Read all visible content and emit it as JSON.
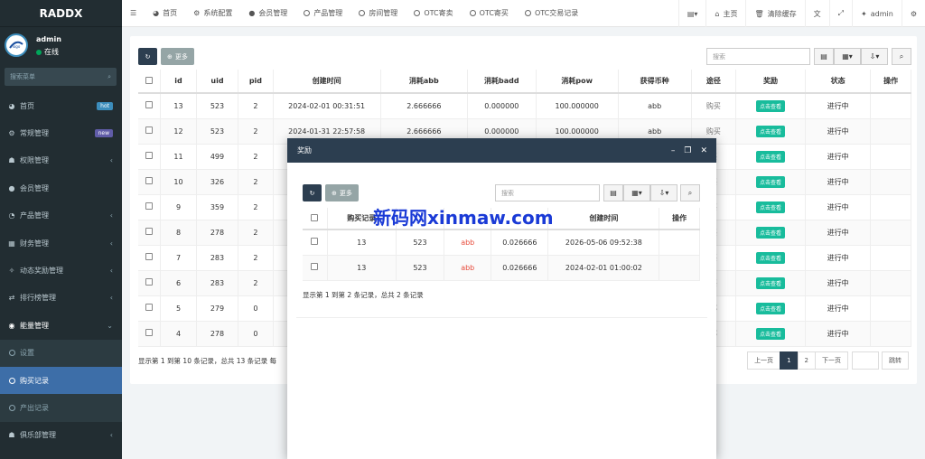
{
  "brand": {
    "title": "RADDX"
  },
  "user": {
    "name": "admin",
    "status": "在线"
  },
  "sidebar": {
    "search_placeholder": "搜索菜单",
    "items": [
      {
        "label": "首页",
        "icon": "dashboard-icon",
        "badge": "hot",
        "badge_color": "#3c8dbc"
      },
      {
        "label": "常规管理",
        "icon": "cogs-icon",
        "badge": "new",
        "badge_color": "#605ca8"
      },
      {
        "label": "权限管理",
        "icon": "group-icon",
        "chev": "‹"
      },
      {
        "label": "会员管理",
        "icon": "user-icon"
      },
      {
        "label": "产品管理",
        "icon": "product-icon",
        "chev": "‹"
      },
      {
        "label": "财务管理",
        "icon": "finance-icon",
        "chev": "‹"
      },
      {
        "label": "动态奖励管理",
        "icon": "reward-icon",
        "chev": "‹"
      },
      {
        "label": "排行榜管理",
        "icon": "rank-icon",
        "chev": "‹"
      },
      {
        "label": "能量管理",
        "icon": "energy-icon",
        "chev": "⌄"
      }
    ],
    "subitems": [
      {
        "label": "设置"
      },
      {
        "label": "购买记录"
      },
      {
        "label": "产出记录"
      }
    ],
    "last_item": {
      "label": "俱乐部管理",
      "icon": "club-icon",
      "chev": "‹"
    }
  },
  "topbar": {
    "tabs": [
      {
        "label": "首页",
        "icon": "dashboard-icon"
      },
      {
        "label": "系统配置",
        "icon": "gear-icon"
      },
      {
        "label": "会员管理",
        "icon": "user-icon"
      },
      {
        "label": "产品管理",
        "icon": "circle-icon"
      },
      {
        "label": "房间管理",
        "icon": "circle-icon"
      },
      {
        "label": "OTC寄卖",
        "icon": "circle-icon"
      },
      {
        "label": "OTC寄买",
        "icon": "circle-icon"
      },
      {
        "label": "OTC交易记录",
        "icon": "circle-icon"
      }
    ],
    "right": {
      "home": "主页",
      "clear_cache": "清除缓存",
      "admin": "admin"
    }
  },
  "toolbar": {
    "more": "更多",
    "search_placeholder": "搜索"
  },
  "table": {
    "columns": [
      "id",
      "uid",
      "pid",
      "创建时间",
      "消耗abb",
      "消耗badd",
      "消耗pow",
      "获得币种",
      "途径",
      "奖励",
      "状态",
      "操作"
    ],
    "rows": [
      {
        "id": "13",
        "uid": "523",
        "pid": "2",
        "time": "2024-02-01 00:31:51",
        "abb": "2.666666",
        "badd": "0.000000",
        "pow": "100.000000",
        "coin": "abb",
        "way": "购买",
        "status": "进行中"
      },
      {
        "id": "12",
        "uid": "523",
        "pid": "2",
        "time": "2024-01-31 22:57:58",
        "abb": "2.666666",
        "badd": "0.000000",
        "pow": "100.000000",
        "coin": "abb",
        "way": "购买",
        "status": "进行中"
      },
      {
        "id": "11",
        "uid": "499",
        "pid": "2",
        "time": "",
        "abb": "",
        "badd": "",
        "pow": "",
        "coin": "",
        "way": "买",
        "status": "进行中"
      },
      {
        "id": "10",
        "uid": "326",
        "pid": "2",
        "time": "",
        "abb": "",
        "badd": "",
        "pow": "",
        "coin": "",
        "way": "买",
        "status": "进行中"
      },
      {
        "id": "9",
        "uid": "359",
        "pid": "2",
        "time": "",
        "abb": "",
        "badd": "",
        "pow": "",
        "coin": "",
        "way": "买",
        "status": "进行中"
      },
      {
        "id": "8",
        "uid": "278",
        "pid": "2",
        "time": "",
        "abb": "",
        "badd": "",
        "pow": "",
        "coin": "",
        "way": "买",
        "status": "进行中"
      },
      {
        "id": "7",
        "uid": "283",
        "pid": "2",
        "time": "",
        "abb": "",
        "badd": "",
        "pow": "",
        "coin": "",
        "way": "买",
        "status": "进行中"
      },
      {
        "id": "6",
        "uid": "283",
        "pid": "2",
        "time": "",
        "abb": "",
        "badd": "",
        "pow": "",
        "coin": "",
        "way": "买",
        "status": "进行中"
      },
      {
        "id": "5",
        "uid": "279",
        "pid": "0",
        "time": "",
        "abb": "",
        "badd": "",
        "pow": "",
        "coin": "",
        "way": "部",
        "status": "进行中"
      },
      {
        "id": "4",
        "uid": "278",
        "pid": "0",
        "time": "",
        "abb": "",
        "badd": "",
        "pow": "",
        "coin": "",
        "way": "部",
        "status": "进行中"
      }
    ],
    "view_label": "点击查看",
    "footer": "显示第 1 到第 10 条记录，总共 13 条记录 每"
  },
  "pager": {
    "prev": "上一页",
    "pages": [
      "1",
      "2"
    ],
    "next": "下一页",
    "jump": "跳转"
  },
  "modal": {
    "title": "奖励",
    "more": "更多",
    "search_placeholder": "搜索",
    "watermark": "新码网xinmaw.com",
    "columns": [
      "购买记录",
      "",
      "",
      "",
      "创建时间",
      "操作"
    ],
    "rows": [
      {
        "rec": "13",
        "uid": "523",
        "coin": "abb",
        "amount": "0.026666",
        "time": "2026-05-06 09:52:38"
      },
      {
        "rec": "13",
        "uid": "523",
        "coin": "abb",
        "amount": "0.026666",
        "time": "2024-02-01 01:00:02"
      }
    ],
    "footer": "显示第 1 到第 2 条记录，总共 2 条记录"
  }
}
